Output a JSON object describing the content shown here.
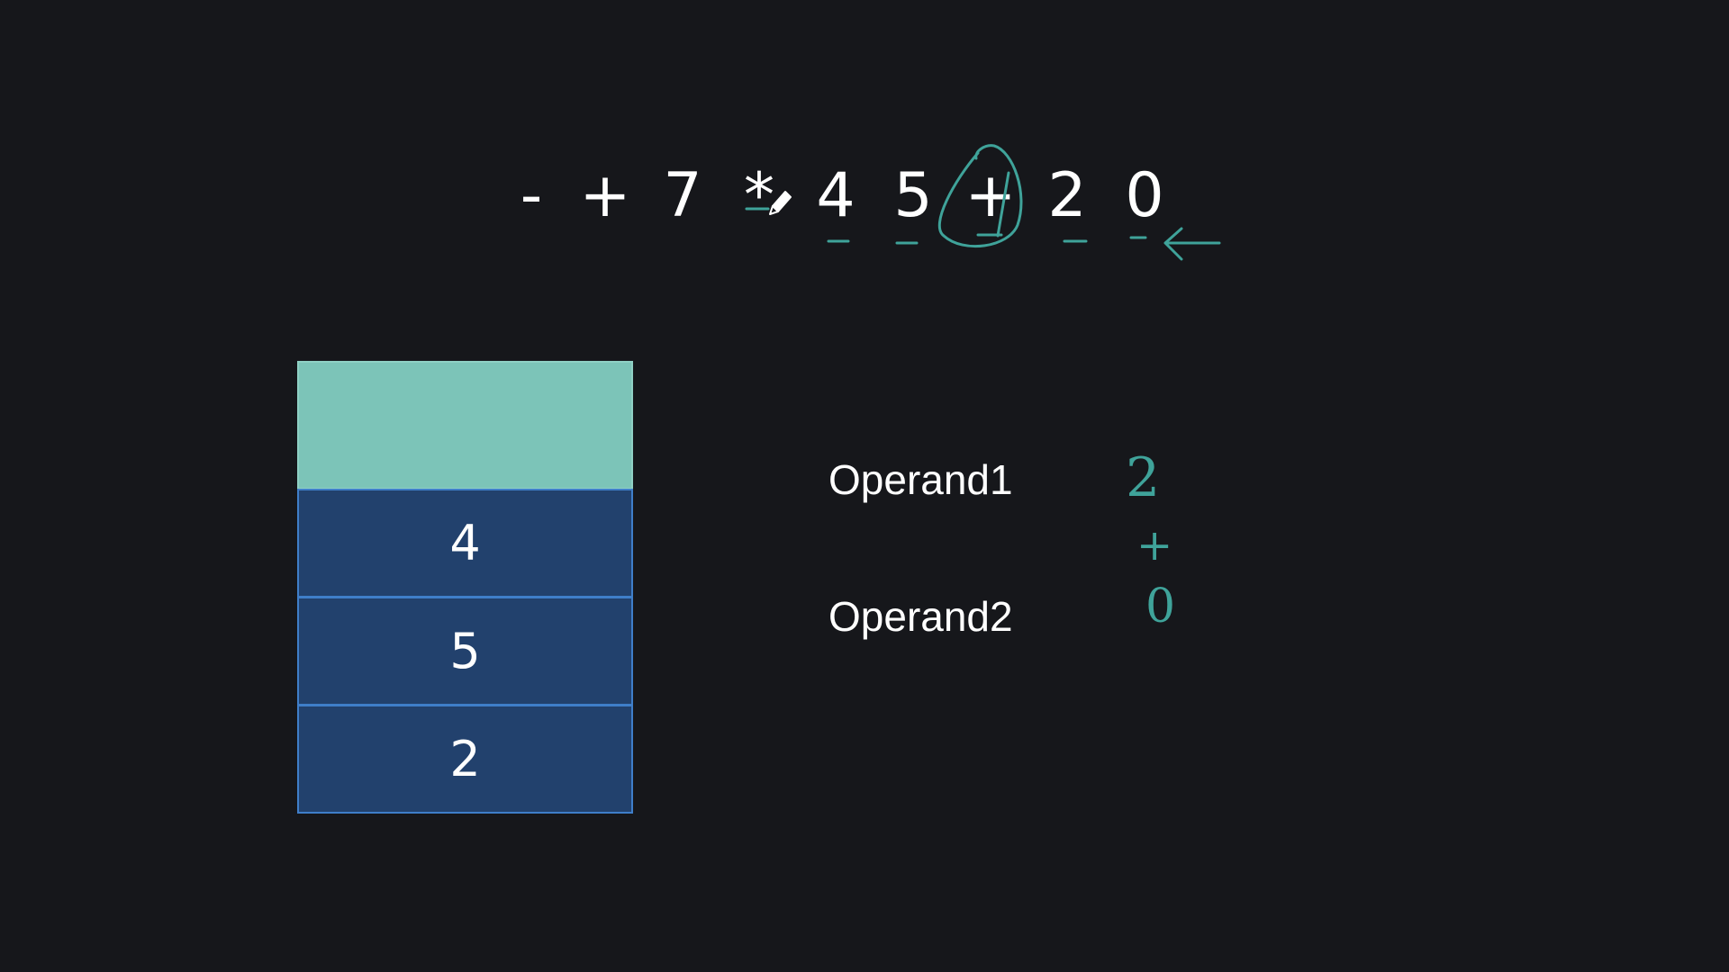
{
  "expression": {
    "tokens": [
      "-",
      "+",
      "7",
      "*",
      "4",
      "5",
      "+",
      "2",
      "0"
    ]
  },
  "stack": {
    "items": [
      "4",
      "5",
      "2"
    ]
  },
  "operands": {
    "operand1_label": "Operand1",
    "operand2_label": "Operand2",
    "operand1_value": "2",
    "operator": "+",
    "operand2_value": "0"
  },
  "annotations": {
    "color": "#3fa39a",
    "icons": [
      "pen-cursor-icon",
      "left-arrow-icon",
      "circle-highlight"
    ]
  },
  "colors": {
    "background": "#16171b",
    "stack_top": "#7cc4b8",
    "stack_cell": "#22416d",
    "stack_border": "#3f7ec9"
  }
}
